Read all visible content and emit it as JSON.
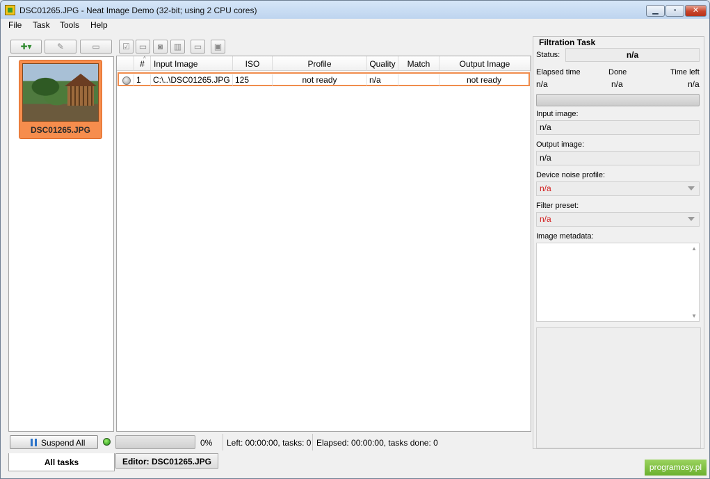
{
  "window": {
    "title": "DSC01265.JPG - Neat Image Demo (32-bit; using 2 CPU cores)",
    "minimize_glyph": "▁",
    "maximize_glyph": "▫",
    "close_glyph": "✕"
  },
  "menu": [
    "File",
    "Task",
    "Tools",
    "Help"
  ],
  "toolbar": {
    "add_icon": "add-files-icon",
    "edit_icon": "edit-icon",
    "remove_icon": "remove-icon",
    "tool_icons": [
      "check-list-icon",
      "open-folder-icon",
      "load-profile-icon",
      "histogram-icon",
      "browse-folder-icon",
      "save-icon"
    ]
  },
  "thumbnails": [
    {
      "label": "DSC01265.JPG"
    }
  ],
  "table": {
    "sort_glyph": "^",
    "headers": [
      "#",
      "Input Image",
      "ISO",
      "Profile",
      "Quality",
      "Match",
      "Output Image"
    ],
    "rows": [
      {
        "num": "1",
        "input": "C:\\..\\DSC01265.JPG",
        "iso": "125",
        "profile": "not ready",
        "quality": "n/a",
        "match": "",
        "output": "not ready"
      }
    ]
  },
  "status_strip": {
    "suspend_label": "Suspend All",
    "progress_percent": "0%",
    "progress_value": 0,
    "left_text": "Left: 00:00:00, tasks: 0",
    "elapsed_text": "Elapsed: 00:00:00, tasks done: 0"
  },
  "tabs": {
    "all_tasks": "All tasks",
    "editor": "Editor: DSC01265.JPG"
  },
  "filtration": {
    "title": "Filtration Task",
    "status_label": "Status:",
    "status_value": "n/a",
    "elapsed_label": "Elapsed time",
    "done_label": "Done",
    "timeleft_label": "Time left",
    "elapsed_value": "n/a",
    "done_value": "n/a",
    "timeleft_value": "n/a",
    "input_label": "Input image:",
    "input_value": "n/a",
    "output_label": "Output image:",
    "output_value": "n/a",
    "noise_profile_label": "Device noise profile:",
    "noise_profile_value": "n/a",
    "filter_preset_label": "Filter preset:",
    "filter_preset_value": "n/a",
    "metadata_label": "Image metadata:",
    "scroll_up_glyph": "▲",
    "scroll_down_glyph": "▼"
  },
  "badge": "programosy.pl",
  "colors": {
    "selection": "#f08c4c",
    "led_green": "#1c8a12",
    "error_red": "#d21a1a",
    "pause_blue": "#2b73c9"
  }
}
